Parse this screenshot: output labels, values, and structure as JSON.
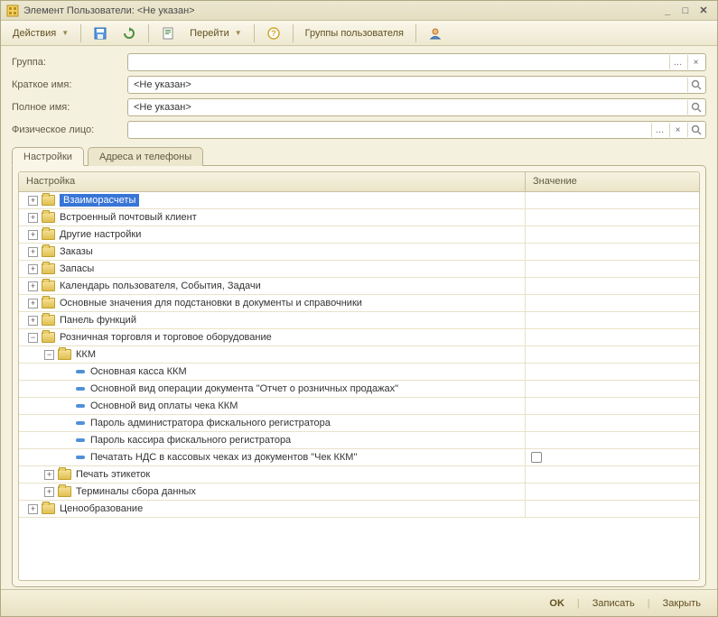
{
  "window": {
    "title": "Элемент Пользователи: <Не указан>"
  },
  "toolbar": {
    "actions": "Действия",
    "go": "Перейти",
    "user_groups": "Группы пользователя"
  },
  "form": {
    "group_label": "Группа:",
    "group_value": "",
    "shortname_label": "Краткое имя:",
    "shortname_value": "<Не указан>",
    "fullname_label": "Полное имя:",
    "fullname_value": "<Не указан>",
    "person_label": "Физическое лицо:",
    "person_value": ""
  },
  "tabs": {
    "settings": "Настройки",
    "addresses": "Адреса и телефоны"
  },
  "columns": {
    "setting": "Настройка",
    "value": "Значение"
  },
  "tree": [
    {
      "d": 0,
      "t": "folder",
      "e": "+",
      "label": "Взаиморасчеты",
      "sel": true
    },
    {
      "d": 0,
      "t": "folder",
      "e": "+",
      "label": "Встроенный почтовый клиент"
    },
    {
      "d": 0,
      "t": "folder",
      "e": "+",
      "label": "Другие настройки"
    },
    {
      "d": 0,
      "t": "folder",
      "e": "+",
      "label": "Заказы"
    },
    {
      "d": 0,
      "t": "folder",
      "e": "+",
      "label": "Запасы"
    },
    {
      "d": 0,
      "t": "folder",
      "e": "+",
      "label": "Календарь пользователя, События, Задачи"
    },
    {
      "d": 0,
      "t": "folder",
      "e": "+",
      "label": "Основные значения для подстановки в документы и справочники"
    },
    {
      "d": 0,
      "t": "folder",
      "e": "+",
      "label": "Панель функций"
    },
    {
      "d": 0,
      "t": "folder",
      "e": "-",
      "label": "Розничная торговля и торговое оборудование"
    },
    {
      "d": 1,
      "t": "folder",
      "e": "-",
      "label": "ККМ"
    },
    {
      "d": 2,
      "t": "leaf",
      "label": "Основная касса ККМ"
    },
    {
      "d": 2,
      "t": "leaf",
      "label": "Основной вид операции документа \"Отчет о розничных продажах\""
    },
    {
      "d": 2,
      "t": "leaf",
      "label": "Основной вид оплаты чека ККМ"
    },
    {
      "d": 2,
      "t": "leaf",
      "label": "Пароль администратора фискального регистратора"
    },
    {
      "d": 2,
      "t": "leaf",
      "label": "Пароль кассира фискального регистратора"
    },
    {
      "d": 2,
      "t": "leaf",
      "label": "Печатать НДС в кассовых чеках из документов \"Чек ККМ\"",
      "chk": true
    },
    {
      "d": 1,
      "t": "folder",
      "e": "+",
      "label": "Печать этикеток"
    },
    {
      "d": 1,
      "t": "folder",
      "e": "+",
      "label": "Терминалы сбора данных"
    },
    {
      "d": 0,
      "t": "folder",
      "e": "+",
      "label": "Ценообразование"
    }
  ],
  "footer": {
    "ok": "OK",
    "save": "Записать",
    "close": "Закрыть"
  }
}
